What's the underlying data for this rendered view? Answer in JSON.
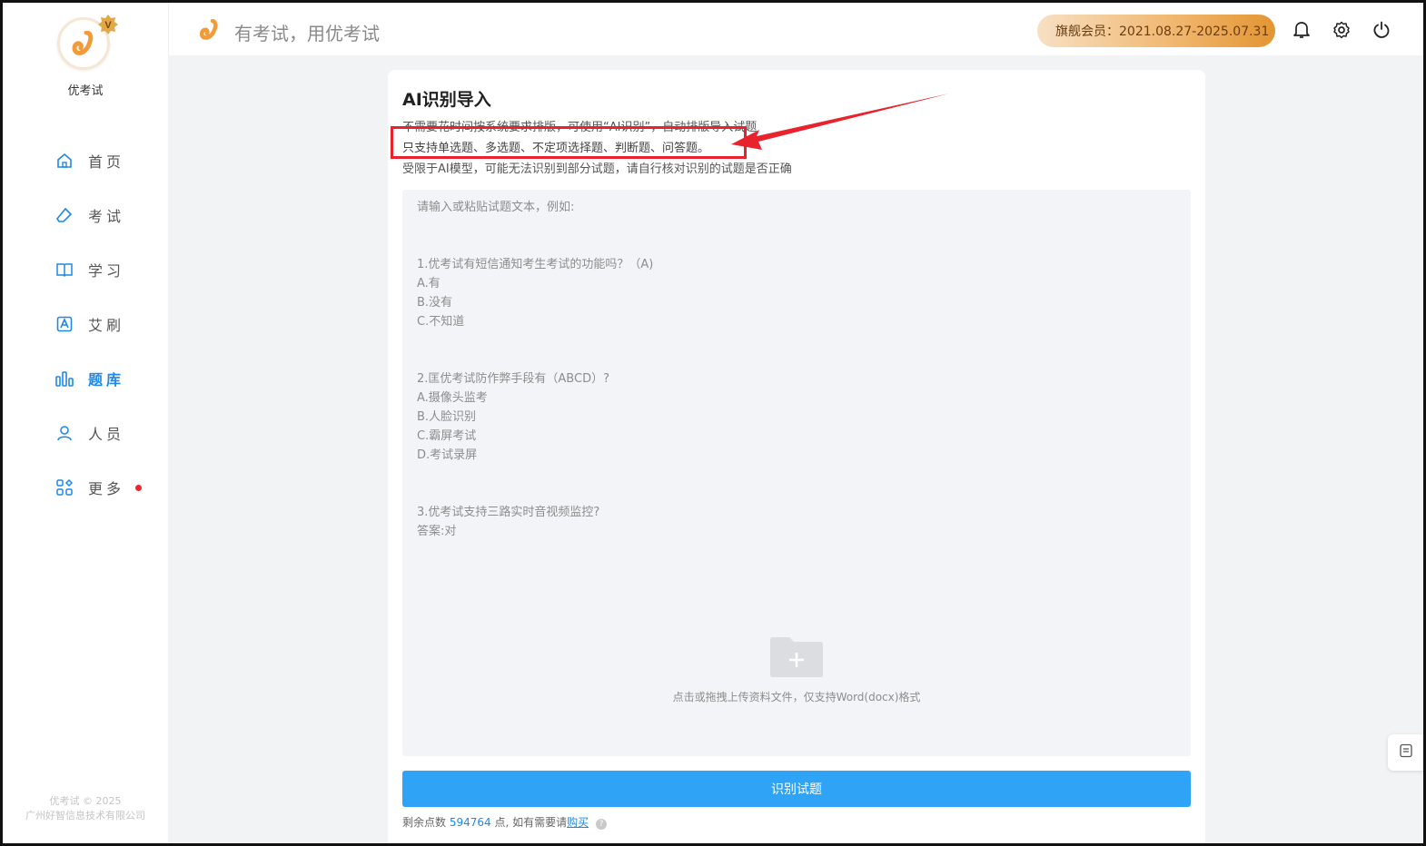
{
  "brand": {
    "name": "优考试",
    "badge_letter": "V"
  },
  "header": {
    "slogan": "有考试，用优考试",
    "member": "旗舰会员：2021.08.27-2025.07.31"
  },
  "nav": [
    {
      "label": "首页",
      "icon": "home-icon"
    },
    {
      "label": "考试",
      "icon": "eraser-icon"
    },
    {
      "label": "学习",
      "icon": "book-icon"
    },
    {
      "label": "艾刷",
      "icon": "letter-a-icon"
    },
    {
      "label": "题库",
      "icon": "bar-chart-icon",
      "active": true
    },
    {
      "label": "人员",
      "icon": "user-icon"
    },
    {
      "label": "更多",
      "icon": "apps-icon",
      "dot": true
    }
  ],
  "footer": {
    "line1": "优考试 © 2025",
    "line2": "广州好智信息技术有限公司"
  },
  "card": {
    "title": "AI识别导入",
    "tips": [
      "不需要花时间按系统要求排版，可使用“AI识别”，自动排版导入试题",
      "只支持单选题、多选题、不定项选择题、判断题、问答题。",
      "受限于AI模型，可能无法识别到部分试题，请自行核对识别的试题是否正确"
    ],
    "placeholder_lines": [
      "请输入或粘贴试题文本，例如:",
      "1.优考试有短信通知考生考试的功能吗？（A)",
      "A.有",
      "B.没有",
      "C.不知道",
      "2.匡优考试防作弊手段有（ABCD）?",
      "A.摄像头监考",
      "B.人脸识别",
      "C.霸屏考试",
      "D.考试录屏",
      "3.优考试支持三路实时音视频监控?",
      "答案:对"
    ],
    "upload_hint": "点击或拖拽上传资料文件，仅支持Word(docx)格式",
    "button": "识别试题",
    "points_prefix": "剩余点数",
    "points_value": "594764",
    "points_suffix": "点, 如有需要请",
    "buy_link": "购买"
  },
  "colors": {
    "accent": "#1e88e5",
    "button": "#2fa3f6",
    "annotation": "#e8232d"
  }
}
